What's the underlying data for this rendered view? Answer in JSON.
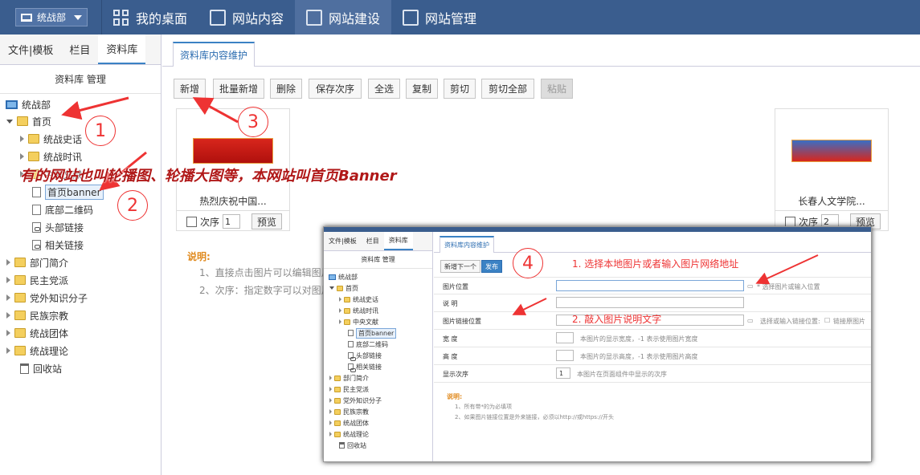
{
  "topbar": {
    "site_label": "统战部",
    "nav": [
      {
        "label": "我的桌面"
      },
      {
        "label": "网站内容"
      },
      {
        "label": "网站建设"
      },
      {
        "label": "网站管理"
      }
    ]
  },
  "left": {
    "tabs": [
      "文件|模板",
      "栏目",
      "资料库"
    ],
    "header": "资料库 管理",
    "tree": {
      "root": "统战部",
      "home": "首页",
      "home_children": [
        "统战史话",
        "统战时讯",
        "中央文献",
        "首页banner",
        "底部二维码",
        "头部链接",
        "相关链接"
      ],
      "others": [
        "部门简介",
        "民主党派",
        "党外知识分子",
        "民族宗教",
        "统战团体",
        "统战理论"
      ],
      "trash": "回收站"
    }
  },
  "main": {
    "tab": "资料库内容维护",
    "toolbar": [
      "新增",
      "批量新增",
      "删除",
      "保存次序",
      "全选",
      "复制",
      "剪切",
      "剪切全部",
      "粘贴"
    ],
    "cards": [
      {
        "caption": "热烈庆祝中国...",
        "order_label": "次序",
        "order": "1",
        "preview": "预览"
      },
      {
        "caption": "长春人文学院...",
        "order_label": "次序",
        "order": "2",
        "preview": "预览"
      }
    ],
    "note_title": "说明:",
    "notes": [
      "1、直接点击图片可以编辑图片",
      "2、次序：指定数字可以对图片"
    ]
  },
  "annotations": {
    "big_text": "有的网站也叫轮播图、轮播大图等，本网站叫首页Banner",
    "circles": [
      "1",
      "2",
      "3",
      "4"
    ],
    "step1": "1. 选择本地图片或者输入图片网络地址",
    "step2": "2. 敲入图片说明文字"
  },
  "inset": {
    "tabs": [
      "文件|模板",
      "栏目",
      "资料库"
    ],
    "header": "资料库 管理",
    "tree_root": "统战部",
    "tree_home": "首页",
    "tree_home_children": [
      "统战史话",
      "统战时讯",
      "中央文献",
      "首页banner",
      "底部二维码",
      "头部链接",
      "相关链接"
    ],
    "tree_others": [
      "部门简介",
      "民主党派",
      "党外知识分子",
      "民族宗教",
      "统战团体",
      "统战理论"
    ],
    "tree_trash": "回收站",
    "tab": "资料库内容维护",
    "btn_next": "新增下一个",
    "btn_publish": "发布",
    "fields": [
      {
        "label": "图片位置",
        "hint": "* 选择图片或输入位置"
      },
      {
        "label": "说 明",
        "hint": ""
      },
      {
        "label": "图片链接位置",
        "hint": "选择或输入链接位置:",
        "extra": "链接原图片"
      },
      {
        "label": "宽 度",
        "hint": "本图片的显示宽度，-1 表示使用图片宽度"
      },
      {
        "label": "高 度",
        "hint": "本图片的显示高度，-1 表示使用图片高度"
      },
      {
        "label": "显示次序",
        "value": "1",
        "hint": "本图片在页面组件中显示的次序"
      }
    ],
    "note_title": "说明:",
    "notes": [
      "1、所有带*的为必填项",
      "2、如果图片链接位置是外来链接，必须以http://或https://开头"
    ]
  },
  "colors": {
    "topbar": "#3a5d8e",
    "accent": "#3b82c4",
    "annotation_red": "#e33"
  }
}
